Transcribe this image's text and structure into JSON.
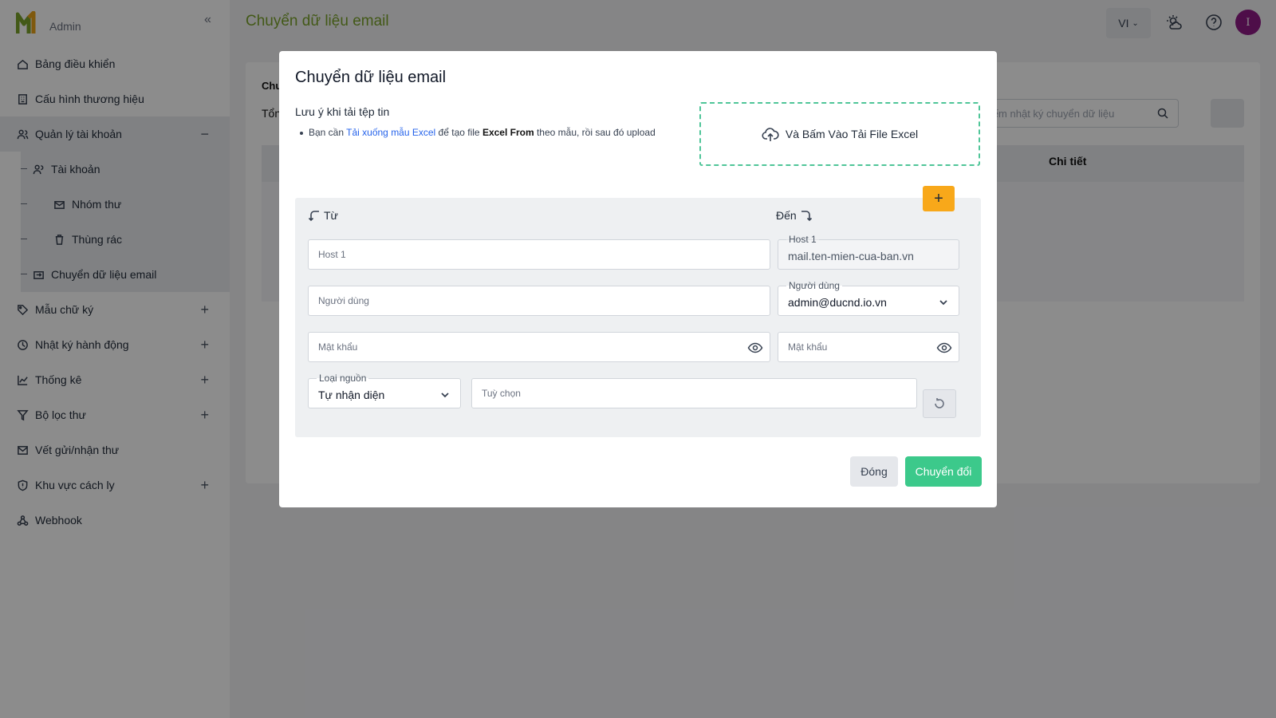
{
  "app": {
    "brand": "Admin",
    "page_title": "Chuyển dữ liệu email",
    "lang": "VI",
    "avatar_initial": "I",
    "accent_color": "#3cc98b",
    "title_color": "#7aa22b"
  },
  "sidebar": {
    "items": [
      {
        "label": "Bảng điều khiển",
        "icon": "dashboard-icon"
      },
      {
        "label": "Cấu hình thương hiệu",
        "icon": "building-icon"
      },
      {
        "label": "Quản lý tài khoản",
        "icon": "users-icon",
        "toggle": "−"
      },
      {
        "label": "Mẫu chữ ký",
        "icon": "tag-icon",
        "toggle": "+"
      },
      {
        "label": "Nhật ký hành động",
        "icon": "log-icon",
        "toggle": "+"
      },
      {
        "label": "Thống kê",
        "icon": "chart-icon",
        "toggle": "+"
      },
      {
        "label": "Bộ lọc thư",
        "icon": "filter-icon",
        "toggle": "+"
      },
      {
        "label": "Vết gửi/nhận thư",
        "icon": "mail-icon"
      },
      {
        "label": "Khu vực cách ly",
        "icon": "shield-icon",
        "toggle": "+"
      },
      {
        "label": "Webhook",
        "icon": "webhook-icon"
      }
    ],
    "sub_items": [
      {
        "label": "Tài khoản",
        "icon": "user-icon"
      },
      {
        "label": "Nhóm thư",
        "icon": "mail-group-icon"
      },
      {
        "label": "Thùng rác",
        "icon": "trash-icon"
      },
      {
        "label": "Chuyển dữ liệu email",
        "icon": "migrate-icon"
      }
    ]
  },
  "background": {
    "card_title": "Chu",
    "total_label": "Tổn",
    "search_placeholder": "m kiếm nhật ký chuyển dữ liệu",
    "column": "Chi tiết"
  },
  "modal": {
    "title": "Chuyển dữ liệu email",
    "note_title": "Lưu ý khi tải tệp tin",
    "note_prefix": "Bạn cần ",
    "note_link": "Tải xuống mẫu Excel",
    "note_mid": " để tạo file ",
    "note_bold": "Excel From",
    "note_suffix": " theo mẫu, rồi sau đó upload",
    "upload_label": "Và Bấm Vào Tải File Excel",
    "add_label": "+",
    "from_label": "Từ",
    "to_label": "Đến",
    "from": {
      "host_placeholder": "Host 1",
      "user_placeholder": "Người dùng",
      "password_placeholder": "Mật khẩu",
      "source_type_label": "Loại nguồn",
      "source_type_value": "Tự nhận diện",
      "options_placeholder": "Tuỳ chọn"
    },
    "to": {
      "host_label": "Host 1",
      "host_value": "mail.ten-mien-cua-ban.vn",
      "user_label": "Người dùng",
      "user_value": "admin@ducnd.io.vn",
      "password_placeholder": "Mật khẩu"
    },
    "close_label": "Đóng",
    "submit_label": "Chuyển đổi"
  }
}
